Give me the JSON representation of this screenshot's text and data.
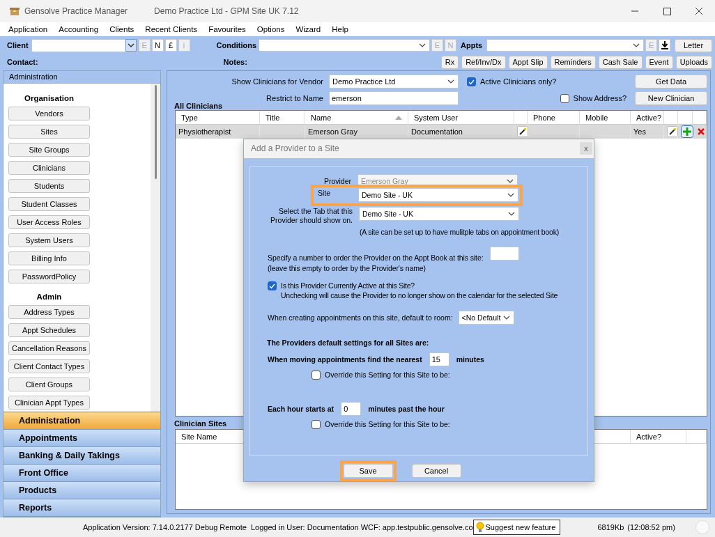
{
  "window": {
    "app_name": "Gensolve Practice Manager",
    "title": "Demo Practice Ltd - GPM Site UK 7.12"
  },
  "menu": [
    "Application",
    "Accounting",
    "Clients",
    "Recent Clients",
    "Favourites",
    "Options",
    "Wizard",
    "Help"
  ],
  "toolbar": {
    "client": {
      "label": "Client",
      "buttons": [
        {
          "label": "E",
          "disabled": true
        },
        {
          "label": "N",
          "disabled": false
        },
        {
          "label": "£",
          "disabled": false
        },
        {
          "label": "i",
          "disabled": true
        }
      ]
    },
    "conditions": {
      "label": "Conditions",
      "buttons": [
        {
          "label": "E",
          "disabled": true
        },
        {
          "label": "N",
          "disabled": true
        }
      ]
    },
    "appts": {
      "label": "Appts",
      "buttons": [
        {
          "label": "E",
          "disabled": true
        }
      ]
    },
    "letter": "Letter",
    "contact_label": "Contact:",
    "notes_label": "Notes:",
    "actions": [
      "Rx",
      "Ref/Inv/Dx",
      "Appt Slip",
      "Reminders",
      "Cash Sale",
      "Event",
      "Uploads"
    ]
  },
  "sidebar": {
    "header": "Administration",
    "sections": [
      {
        "heading": "Organisation",
        "buttons": [
          "Vendors",
          "Sites",
          "Site Groups",
          "Clinicians",
          "Students",
          "Student Classes",
          "User Access Roles",
          "System Users",
          "Billing Info",
          "PasswordPolicy"
        ]
      },
      {
        "heading": "Admin",
        "buttons": [
          "Address Types",
          "Appt Schedules",
          "Cancellation Reasons",
          "Client Contact Types",
          "Client Groups",
          "Clinician Appt Types"
        ]
      }
    ],
    "nav": [
      {
        "label": "Administration",
        "selected": true
      },
      {
        "label": "Appointments",
        "selected": false
      },
      {
        "label": "Banking & Daily Takings",
        "selected": false
      },
      {
        "label": "Front Office",
        "selected": false
      },
      {
        "label": "Products",
        "selected": false
      },
      {
        "label": "Reports",
        "selected": false
      }
    ]
  },
  "clinicians": {
    "vendor_label": "Show Clinicians for Vendor",
    "vendor": "Demo Practice Ltd",
    "active_only": {
      "label": "Active Clinicians only?",
      "checked": true
    },
    "get_data": "Get Data",
    "name_label": "Restrict to Name",
    "name_value": "emerson",
    "show_address": {
      "label": "Show Address?",
      "checked": false
    },
    "new_clinician": "New Clinician",
    "title": "All Clinicians",
    "columns": [
      {
        "label": "Type",
        "sorted": false
      },
      {
        "label": "Title",
        "sorted": false
      },
      {
        "label": "Name",
        "sorted": true
      },
      {
        "label": "System User",
        "sorted": false
      },
      {
        "label": "Phone",
        "sorted": false
      },
      {
        "label": "Mobile",
        "sorted": false
      },
      {
        "label": "Active?",
        "sorted": false
      }
    ],
    "rows": [
      {
        "type": "Physiotherapist",
        "name": "Emerson Gray",
        "system_user": "Documentation",
        "active": "Yes",
        "selected": true
      }
    ]
  },
  "sites": {
    "title": "Clinician Sites",
    "columns": [
      "Site Name",
      "Active?"
    ]
  },
  "dialog": {
    "title": "Add a Provider to a Site",
    "close": "x",
    "provider": {
      "label": "Provider",
      "value": "Emerson Gray",
      "disabled": true
    },
    "site": {
      "label": "Site",
      "value": "Demo Site - UK",
      "highlighted": true
    },
    "tab": {
      "label": "Select the Tab that this Provider should show on.",
      "value": "Demo Site - UK"
    },
    "tab_note": "(A site can be set up to have mulitple tabs on appointment book)",
    "order": {
      "label": "Specify a number to order the Provider on the Appt Book at this site:",
      "hint": "(leave this empty to order by the Provider's name)"
    },
    "active": {
      "label": "Is this Provider Currently Active at this Site?",
      "detail": "Unchecking will cause the Provider to no longer show on the calendar for the selected Site",
      "checked": true
    },
    "room": {
      "label": "When creating appointments on this site, default to room:",
      "value": "<No Default"
    },
    "defaults_heading": "The Providers default settings for all Sites are:",
    "nearest": {
      "label": "When moving appointments find the nearest",
      "value": "15",
      "unit": "minutes",
      "override": {
        "label": "Override this Setting for this Site to be:",
        "checked": false
      }
    },
    "hour": {
      "label": "Each hour starts at",
      "value": "0",
      "unit": "minutes past the hour",
      "override": {
        "label": "Override this Setting for this Site to be:",
        "checked": false
      }
    },
    "buttons": [
      {
        "label": "Save",
        "highlighted": true
      },
      {
        "label": "Cancel",
        "highlighted": false
      }
    ]
  },
  "status": {
    "info": "Application Version: 7.14.0.2177 Debug Remote  Logged in User: Documentation WCF: app.testpublic.gensolve.co",
    "suggest": "Suggest new feature",
    "memory": "6819Kb",
    "time": "(12:08:52 pm)"
  }
}
